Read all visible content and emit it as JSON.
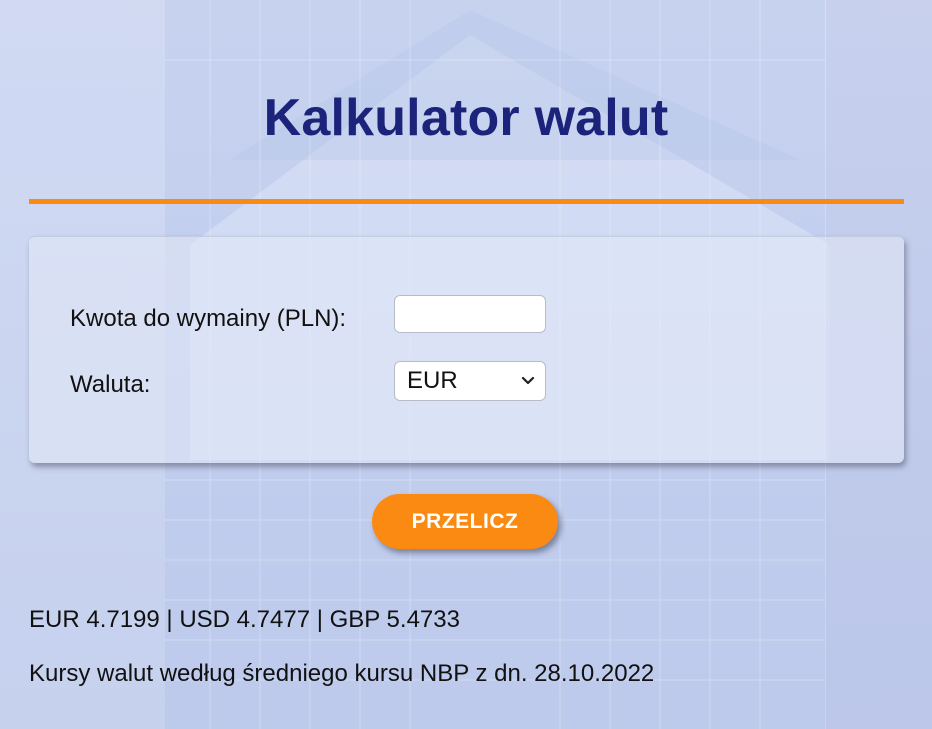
{
  "header": {
    "title": "Kalkulator walut"
  },
  "form": {
    "amount_label": "Kwota do wymainy (PLN):",
    "amount_value": "",
    "currency_label": "Waluta:",
    "currency_selected": "EUR"
  },
  "actions": {
    "convert_label": "PRZELICZ"
  },
  "rates": {
    "summary": "EUR 4.7199 | USD 4.7477 | GBP 5.4733",
    "note": "Kursy walut według średniego kursu NBP z dn. 28.10.2022"
  },
  "icons": {
    "select_chevron": "chevron-down-icon"
  },
  "colors": {
    "title": "#1b237a",
    "accent": "#fb8a12",
    "background": "#d2dbf2"
  }
}
